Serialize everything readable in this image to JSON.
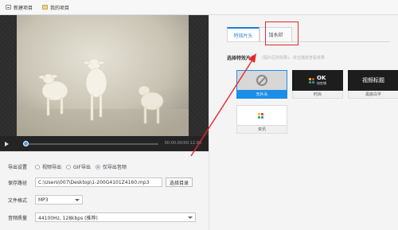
{
  "toolbar": {
    "new_project": "新建项目",
    "my_projects": "我的项目"
  },
  "player": {
    "time": "00:00.00/00:12.00"
  },
  "settings": {
    "export_label": "导出设置",
    "options": [
      "视频导出",
      "GIF导出",
      "仅导出音频"
    ],
    "save_path_label": "保存路径",
    "save_path_value": "C:\\Users\\007\\Desktop\\1-200G4101Z4160.mp3",
    "choose_dir": "选择目录",
    "format_label": "文件格式",
    "format_value": "MP3",
    "quality_label": "音频质量",
    "quality_value": "44100Hz, 128kbps (推荐)"
  },
  "effects": {
    "tabs": [
      "特效片头",
      "加水印"
    ],
    "section_title": "选择特效片头",
    "section_hint": "(图片区的效果)，单击播放查看效果",
    "cards": [
      "无片头",
      "时尚",
      "黑底白字",
      "资讯"
    ],
    "logo_text": "OK",
    "logo_sub": "快剪辑",
    "video_title": "视频标题"
  }
}
